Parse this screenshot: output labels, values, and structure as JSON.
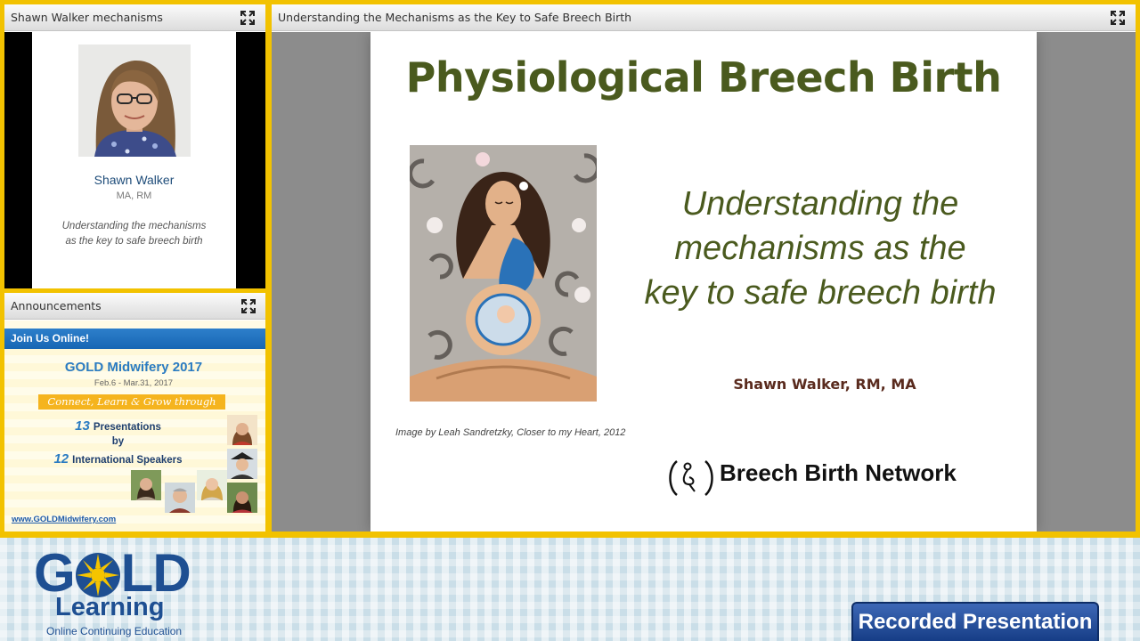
{
  "speaker_panel": {
    "title": "Shawn Walker mechanisms",
    "name": "Shawn Walker",
    "credentials": "MA, RM",
    "topic_line1": "Understanding the mechanisms",
    "topic_line2": "as the key to safe breech birth"
  },
  "announcements_panel": {
    "title": "Announcements",
    "banner": "Join Us Online!",
    "event_title": "GOLD Midwifery 2017",
    "event_dates": "Feb.6 - Mar.31, 2017",
    "tagline": "Connect, Learn & Grow through",
    "presentations_count": "13",
    "presentations_label": "Presentations",
    "by": "by",
    "speakers_count": "12",
    "speakers_label": "International Speakers",
    "url": "www.GOLDMidwifery.com"
  },
  "main_panel": {
    "title": "Understanding the Mechanisms as the Key to Safe Breech Birth"
  },
  "slide": {
    "title": "Physiological Breech Birth",
    "subtitle_line1": "Understanding the",
    "subtitle_line2": "mechanisms as the",
    "subtitle_line3": "key to safe breech birth",
    "author": "Shawn Walker, RM, MA",
    "image_credit": "Image by Leah Sandretzky, Closer to my Heart, 2012",
    "network_name": "Breech Birth Network"
  },
  "footer": {
    "logo_word_pre": "G",
    "logo_word_post": "LD",
    "logo_learning": "Learning",
    "logo_tagline": "Online Continuing Education",
    "badge": "Recorded Presentation"
  },
  "icons": {
    "expand": "expand-icon",
    "sun": "sun-icon"
  },
  "colors": {
    "frame": "#f2c200",
    "slide_green": "#4a5a1e",
    "author_brown": "#5a2b1e",
    "brand_blue": "#1e4f92",
    "banner_blue": "#1766b4"
  }
}
